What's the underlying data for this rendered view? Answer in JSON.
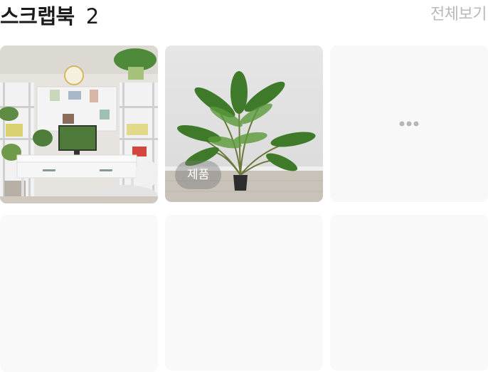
{
  "header": {
    "title": "스크랩북",
    "count": "2",
    "view_all_label": "전체보기"
  },
  "items": [
    {
      "kind": "photo",
      "subject": "desk-shelf-room-photo"
    },
    {
      "kind": "photo",
      "subject": "potted-palm-photo",
      "badge": "제품"
    },
    {
      "kind": "more",
      "icon": "more-dots-icon"
    },
    {
      "kind": "placeholder"
    },
    {
      "kind": "placeholder"
    },
    {
      "kind": "placeholder"
    }
  ],
  "colors": {
    "title_text": "#1b1b1b",
    "muted_text": "#b9b9b9",
    "placeholder_bg": "#f9f9f9",
    "dots": "#b6b6b6"
  }
}
